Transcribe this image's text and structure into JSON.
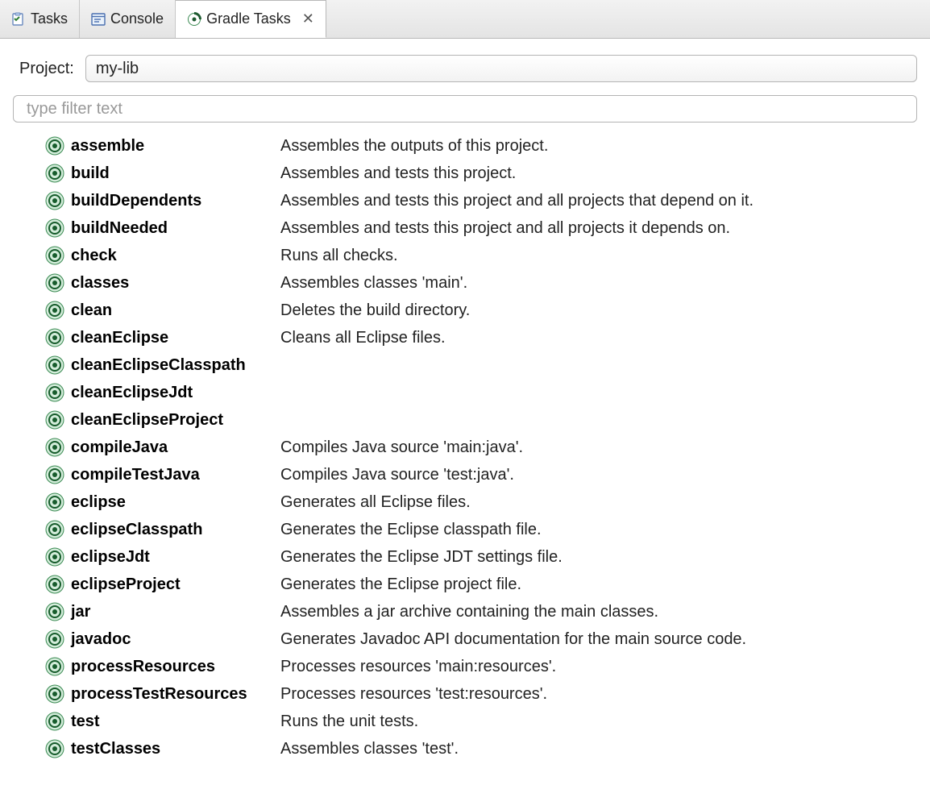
{
  "tabs": [
    {
      "label": "Tasks",
      "active": false,
      "icon": "tasks"
    },
    {
      "label": "Console",
      "active": false,
      "icon": "console"
    },
    {
      "label": "Gradle Tasks",
      "active": true,
      "icon": "gradle",
      "closable": true
    }
  ],
  "project": {
    "label": "Project:",
    "selected": "my-lib"
  },
  "filter": {
    "placeholder": "type filter text"
  },
  "tasks": [
    {
      "name": "assemble",
      "desc": "Assembles the outputs of this project."
    },
    {
      "name": "build",
      "desc": "Assembles and tests this project."
    },
    {
      "name": "buildDependents",
      "desc": "Assembles and tests this project and all projects that depend on it."
    },
    {
      "name": "buildNeeded",
      "desc": "Assembles and tests this project and all projects it depends on."
    },
    {
      "name": "check",
      "desc": "Runs all checks."
    },
    {
      "name": "classes",
      "desc": "Assembles classes 'main'."
    },
    {
      "name": "clean",
      "desc": "Deletes the build directory."
    },
    {
      "name": "cleanEclipse",
      "desc": "Cleans all Eclipse files."
    },
    {
      "name": "cleanEclipseClasspath",
      "desc": ""
    },
    {
      "name": "cleanEclipseJdt",
      "desc": ""
    },
    {
      "name": "cleanEclipseProject",
      "desc": ""
    },
    {
      "name": "compileJava",
      "desc": "Compiles Java source 'main:java'."
    },
    {
      "name": "compileTestJava",
      "desc": "Compiles Java source 'test:java'."
    },
    {
      "name": "eclipse",
      "desc": "Generates all Eclipse files."
    },
    {
      "name": "eclipseClasspath",
      "desc": "Generates the Eclipse classpath file."
    },
    {
      "name": "eclipseJdt",
      "desc": "Generates the Eclipse JDT settings file."
    },
    {
      "name": "eclipseProject",
      "desc": "Generates the Eclipse project file."
    },
    {
      "name": "jar",
      "desc": "Assembles a jar archive containing the main classes."
    },
    {
      "name": "javadoc",
      "desc": "Generates Javadoc API documentation for the main source code."
    },
    {
      "name": "processResources",
      "desc": "Processes resources 'main:resources'."
    },
    {
      "name": "processTestResources",
      "desc": "Processes resources 'test:resources'."
    },
    {
      "name": "test",
      "desc": "Runs the unit tests."
    },
    {
      "name": "testClasses",
      "desc": "Assembles classes 'test'."
    }
  ]
}
